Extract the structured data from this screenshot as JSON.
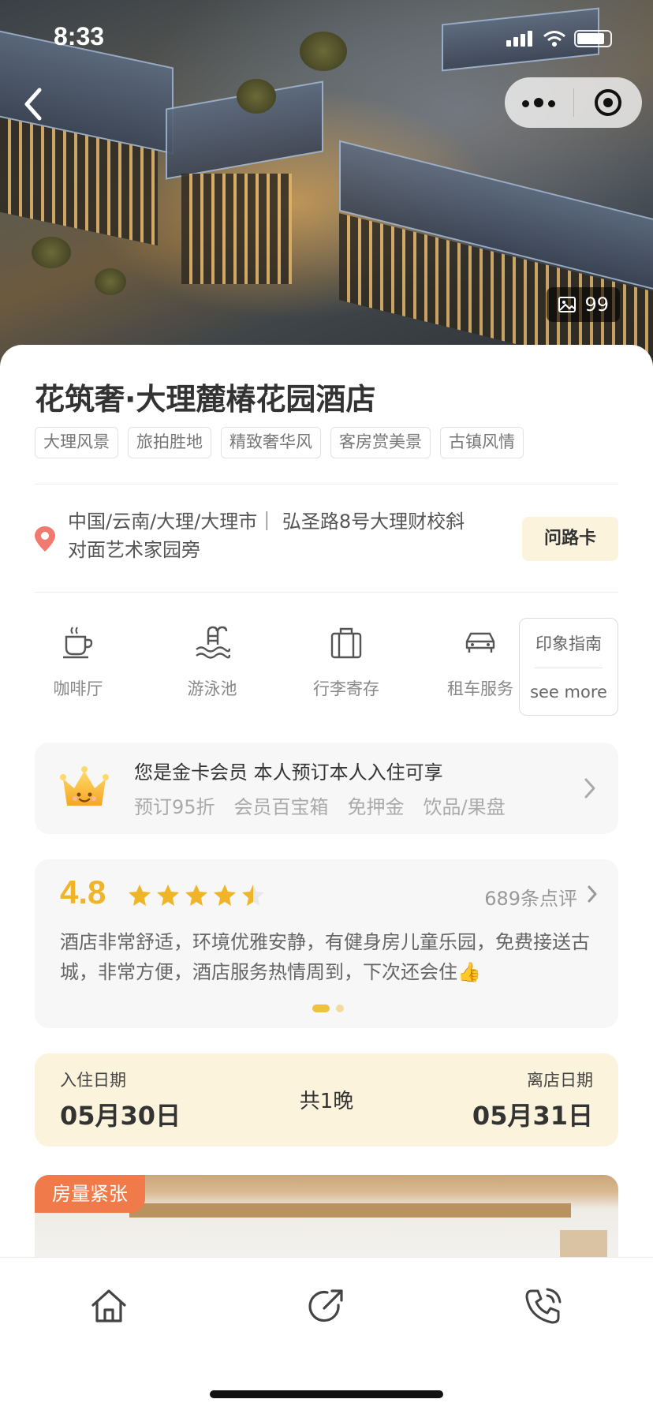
{
  "status_bar": {
    "time": "8:33"
  },
  "hero": {
    "photo_count": "99"
  },
  "hotel": {
    "name": "花筑奢·大理麓椿花园酒店",
    "tags": [
      "大理风景",
      "旅拍胜地",
      "精致奢华风",
      "客房赏美景",
      "古镇风情"
    ],
    "address": "中国/云南/大理/大理市｜ 弘圣路8号大理财校斜对面艺术家园旁",
    "route_button": "问路卡"
  },
  "facilities": [
    {
      "label": "咖啡厅",
      "icon": "coffee-cup-icon"
    },
    {
      "label": "游泳池",
      "icon": "swimming-pool-icon"
    },
    {
      "label": "行李寄存",
      "icon": "luggage-icon"
    },
    {
      "label": "租车服务",
      "icon": "car-icon"
    }
  ],
  "guide": {
    "title": "印象指南",
    "more": "see more"
  },
  "membership": {
    "title": "您是金卡会员 本人预订本人入住可享",
    "perks": [
      "预订95折",
      "会员百宝箱",
      "免押金",
      "饮品/果盘"
    ]
  },
  "review": {
    "score": "4.8",
    "stars": 4.5,
    "count": "689条点评",
    "text": "酒店非常舒适，环境优雅安静，有健身房儿童乐园，免费接送古城，非常方便，酒店服务热情周到，下次还会住👍",
    "page": 1,
    "pages": 2
  },
  "stay": {
    "checkin_label": "入住日期",
    "checkin_date": "05月30日",
    "nights": "共1晚",
    "checkout_label": "离店日期",
    "checkout_date": "05月31日"
  },
  "room": {
    "badge": "房量紧张"
  },
  "colors": {
    "accent": "#f0b428",
    "cream": "#fcf3dc",
    "badge": "#f07a4a"
  },
  "bottom_tabs": [
    "home-icon",
    "share-icon",
    "phone-icon"
  ]
}
